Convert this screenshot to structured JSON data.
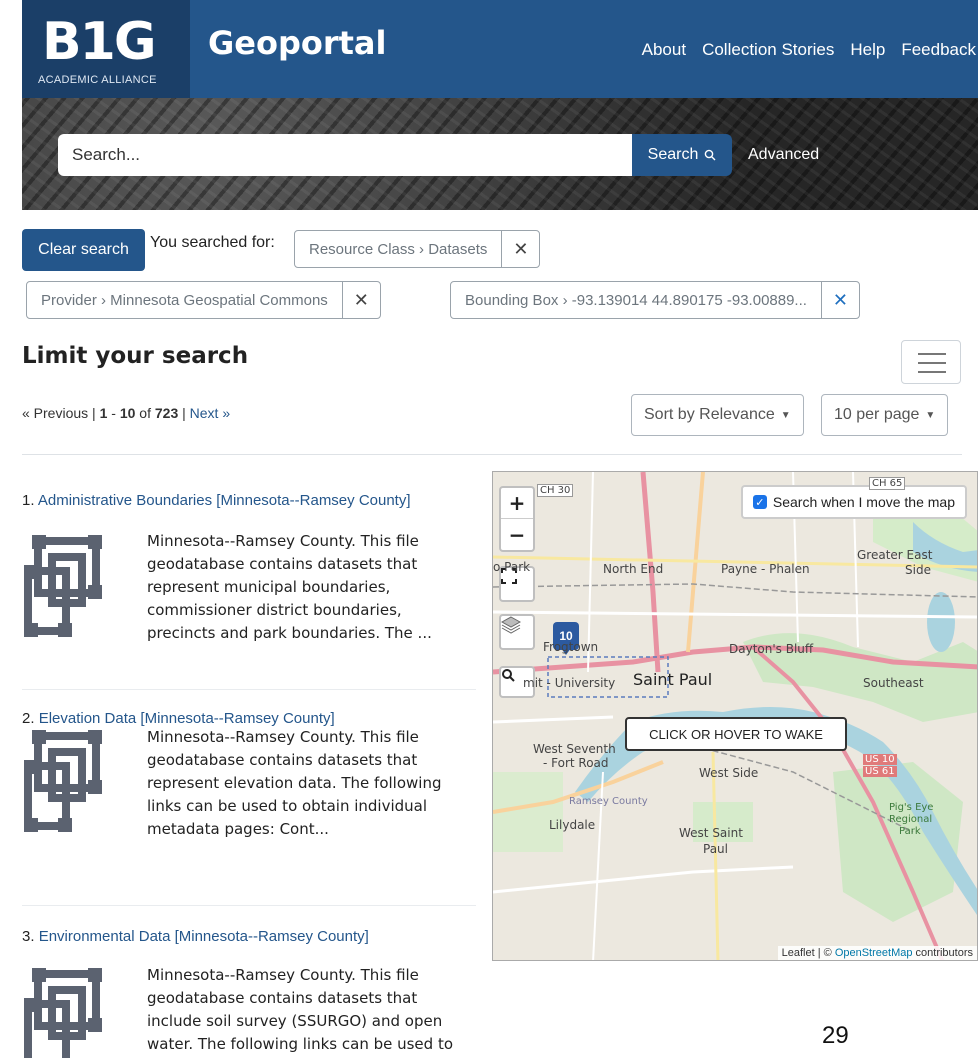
{
  "header": {
    "logo_main": "B1G",
    "logo_sub": "ACADEMIC ALLIANCE",
    "app_title": "Geoportal",
    "nav": [
      "About",
      "Collection Stories",
      "Help",
      "Feedback"
    ]
  },
  "search": {
    "placeholder": "Search...",
    "button_label": "Search",
    "advanced_label": "Advanced"
  },
  "constraints": {
    "clear_label": "Clear search",
    "searched_for_label": "You searched for:",
    "chips": [
      {
        "label": "Resource Class › Datasets"
      },
      {
        "label": "Provider › Minnesota Geospatial Commons"
      },
      {
        "label": "Bounding Box › -93.139014 44.890175 -93.00889..."
      }
    ]
  },
  "limit": {
    "title": "Limit your search"
  },
  "paging": {
    "prev": "« Previous",
    "range_start": "1",
    "range_end": "10",
    "of": "of",
    "total": "723",
    "next": "Next »",
    "sort_label": "Sort by Relevance",
    "per_page_label": "10 per page"
  },
  "results": [
    {
      "number": "1.",
      "title": "Administrative Boundaries [Minnesota--Ramsey County]",
      "description": "Minnesota--Ramsey County. This file geodatabase contains datasets that represent municipal boundaries, commissioner district boundaries, precincts and park boundaries. The ..."
    },
    {
      "number": "2.",
      "title": "Elevation Data [Minnesota--Ramsey County]",
      "description": "Minnesota--Ramsey County. This file geodatabase contains datasets that represent elevation data. The following links can be used to obtain individual metadata pages: Cont..."
    },
    {
      "number": "3.",
      "title": "Environmental Data [Minnesota--Ramsey County]",
      "description": "Minnesota--Ramsey County. This file geodatabase contains datasets that include soil survey (SSURGO) and open water. The following links can be used to"
    }
  ],
  "map": {
    "search_move_label": "Search when I move the map",
    "wake_label": "CLICK OR HOVER TO WAKE",
    "marker_count": "10",
    "attribution_leaflet": "Leaflet",
    "attribution_sep": " | © ",
    "attribution_osm": "OpenStreetMap",
    "attribution_tail": " contributors",
    "labels": {
      "north_end": "North End",
      "payne": "Payne - Phalen",
      "greater_east": "Greater East",
      "side": "Side",
      "park": "o Park",
      "frogtown": "Frogtown",
      "daytons": "Dayton's Bluff",
      "saint_paul": "Saint Paul",
      "university": "mit - University",
      "southeast": "Southeast",
      "west_seventh": "West Seventh",
      "fort_road": "- Fort Road",
      "west_side": "West Side",
      "ramsey": "Ramsey County",
      "lilydale": "Lilydale",
      "west_saint": "West Saint",
      "paul": "Paul",
      "pigs_eye": "Pig's Eye",
      "regional": "Regional",
      "park2": "Park",
      "ch30": "CH 30",
      "ch65": "CH 65",
      "us10": "US 10",
      "us61": "US 61"
    }
  },
  "page_number": "29",
  "colors": {
    "brand": "#24568b",
    "brand_dark": "#1b3f68"
  }
}
